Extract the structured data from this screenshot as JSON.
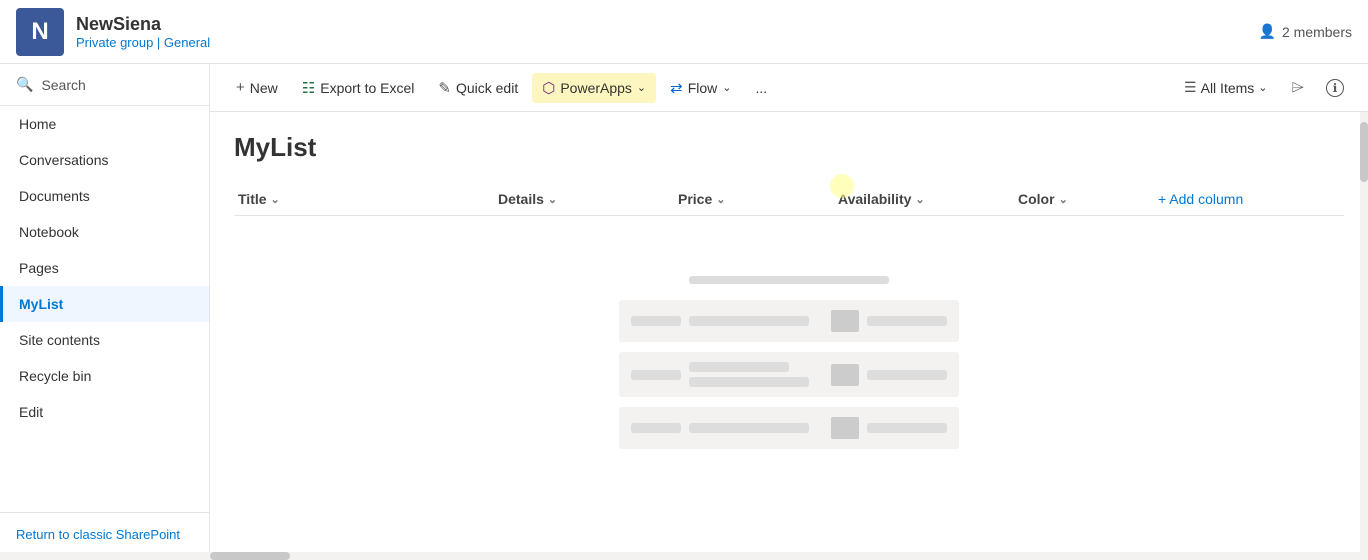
{
  "header": {
    "logo_letter": "N",
    "site_name": "NewSiena",
    "site_meta_prefix": "Private group | ",
    "site_meta_link": "General",
    "members_count": "2 members"
  },
  "sidebar": {
    "search_label": "Search",
    "nav_items": [
      {
        "id": "home",
        "label": "Home",
        "active": false
      },
      {
        "id": "conversations",
        "label": "Conversations",
        "active": false
      },
      {
        "id": "documents",
        "label": "Documents",
        "active": false
      },
      {
        "id": "notebook",
        "label": "Notebook",
        "active": false
      },
      {
        "id": "pages",
        "label": "Pages",
        "active": false
      },
      {
        "id": "mylist",
        "label": "MyList",
        "active": true
      },
      {
        "id": "site-contents",
        "label": "Site contents",
        "active": false
      },
      {
        "id": "recycle-bin",
        "label": "Recycle bin",
        "active": false
      },
      {
        "id": "edit",
        "label": "Edit",
        "active": false
      }
    ],
    "return_label": "Return to classic SharePoint"
  },
  "toolbar": {
    "new_label": "New",
    "export_label": "Export to Excel",
    "quick_edit_label": "Quick edit",
    "power_apps_label": "PowerApps",
    "flow_label": "Flow",
    "more_label": "...",
    "all_items_label": "All Items"
  },
  "list": {
    "title": "MyList",
    "columns": [
      {
        "id": "title",
        "label": "Title"
      },
      {
        "id": "details",
        "label": "Details"
      },
      {
        "id": "price",
        "label": "Price"
      },
      {
        "id": "availability",
        "label": "Availability"
      },
      {
        "id": "color",
        "label": "Color"
      }
    ],
    "add_column_label": "+ Add column"
  }
}
